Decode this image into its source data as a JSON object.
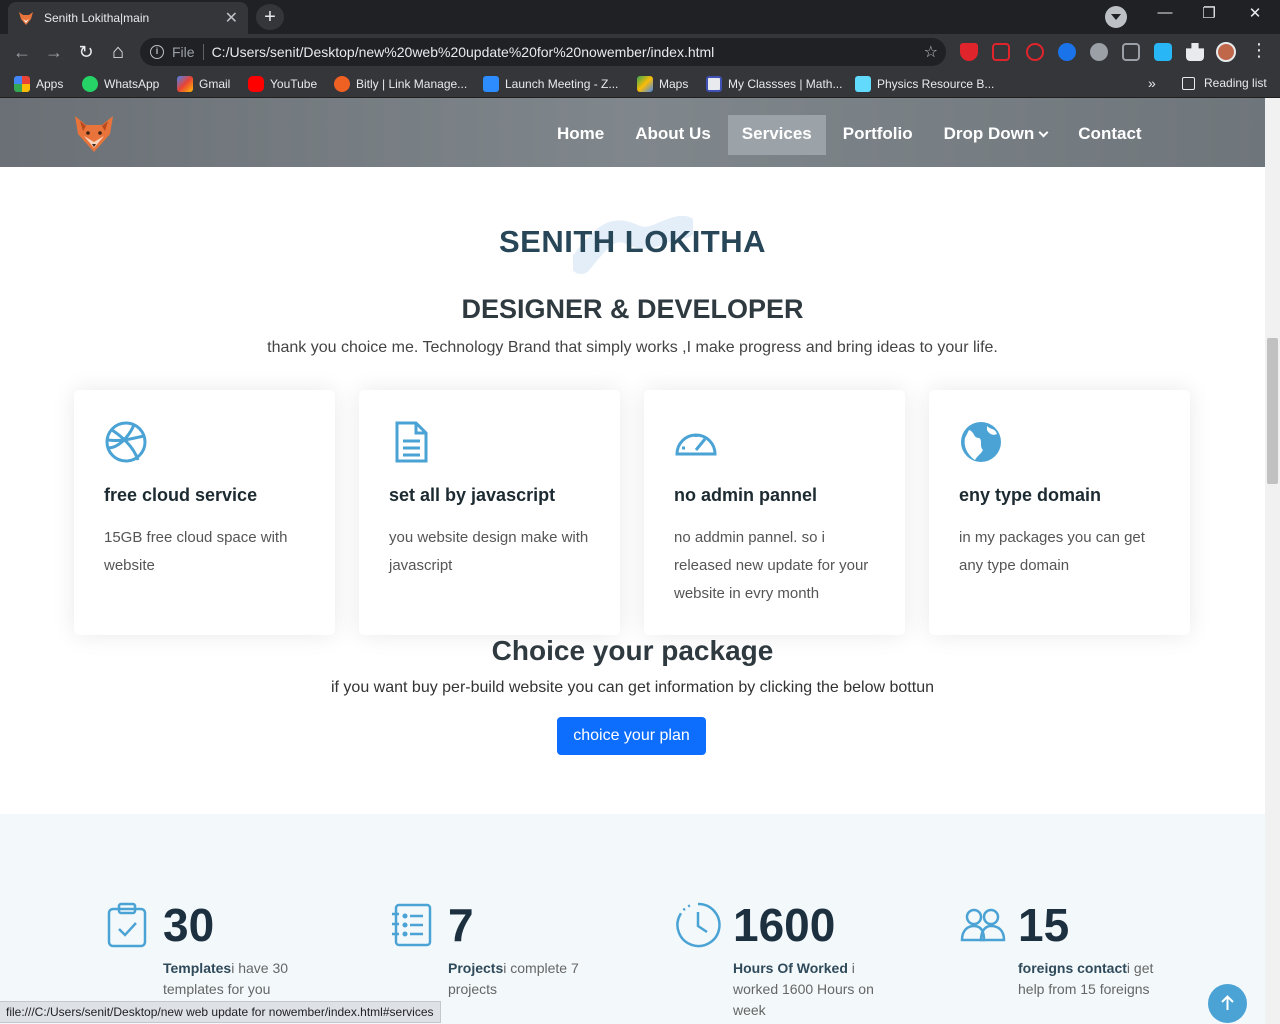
{
  "browser": {
    "tab_title": "Senith Lokitha|main",
    "tab_close": "✕",
    "new_tab": "+",
    "win_min": "—",
    "win_restore": "❐",
    "win_close": "✕",
    "back": "←",
    "forward": "→",
    "reload": "↻",
    "home": "⌂",
    "scheme": "File",
    "url": "C:/Users/senit/Desktop/new%20web%20update%20for%20nowember/index.html",
    "star": "☆",
    "menu": "⋮",
    "bookmarks": [
      {
        "label": "Apps",
        "color": "#ea4335"
      },
      {
        "label": "WhatsApp",
        "color": "#25d366"
      },
      {
        "label": "Gmail",
        "color": "#ea4335"
      },
      {
        "label": "YouTube",
        "color": "#ff0000"
      },
      {
        "label": "Bitly | Link Manage...",
        "color": "#ee6123"
      },
      {
        "label": "Launch Meeting - Z...",
        "color": "#2d8cff"
      },
      {
        "label": "Maps",
        "color": "#34a853"
      },
      {
        "label": "My Classses | Math...",
        "color": "#e8eaed"
      },
      {
        "label": "Physics Resource B...",
        "color": "#61dafb"
      }
    ],
    "bookmarks_more": "»",
    "reading_list": "Reading list",
    "status_url": "file:///C:/Users/senit/Desktop/new web update for nowember/index.html#services"
  },
  "nav": {
    "items": [
      {
        "label": "Home"
      },
      {
        "label": "About Us"
      },
      {
        "label": "Services",
        "active": true
      },
      {
        "label": "Portfolio"
      },
      {
        "label": "Drop Down"
      },
      {
        "label": "Contact"
      }
    ]
  },
  "hero": {
    "title": "SENITH LOKITHA",
    "subtitle": "DESIGNER & DEVELOPER",
    "description": "thank you choice me. Technology Brand that simply works ,I make progress and bring ideas to your life."
  },
  "services": [
    {
      "icon": "dribbble-icon",
      "title": "free cloud service",
      "text": "15GB free cloud space with website"
    },
    {
      "icon": "document-icon",
      "title": "set all by javascript",
      "text": "you website design make with javascript"
    },
    {
      "icon": "speedometer-icon",
      "title": "no admin pannel",
      "text": "no addmin pannel. so i released new update for your website in evry month"
    },
    {
      "icon": "globe-icon",
      "title": "eny type domain",
      "text": "in my packages you can get any type domain"
    }
  ],
  "package": {
    "title": "Choice your package",
    "description": "if you want buy per-build website you can get information by clicking the below bottun",
    "button": "choice your plan"
  },
  "stats": [
    {
      "icon": "clipboard-check-icon",
      "number": "30",
      "label": "Templates",
      "text": "i have 30 templates for you"
    },
    {
      "icon": "journal-list-icon",
      "number": "7",
      "label": "Projects",
      "text": "i complete 7 projects"
    },
    {
      "icon": "clock-icon",
      "number": "1600",
      "label": "Hours Of Worked",
      "text": " i worked 1600 Hours on week"
    },
    {
      "icon": "people-icon",
      "number": "15",
      "label": "foreigns contact",
      "text": "i get help from 15 foreigns"
    }
  ],
  "colors": {
    "accent": "#0d6efd",
    "icon": "#4aa3d4",
    "heading": "#274658"
  }
}
